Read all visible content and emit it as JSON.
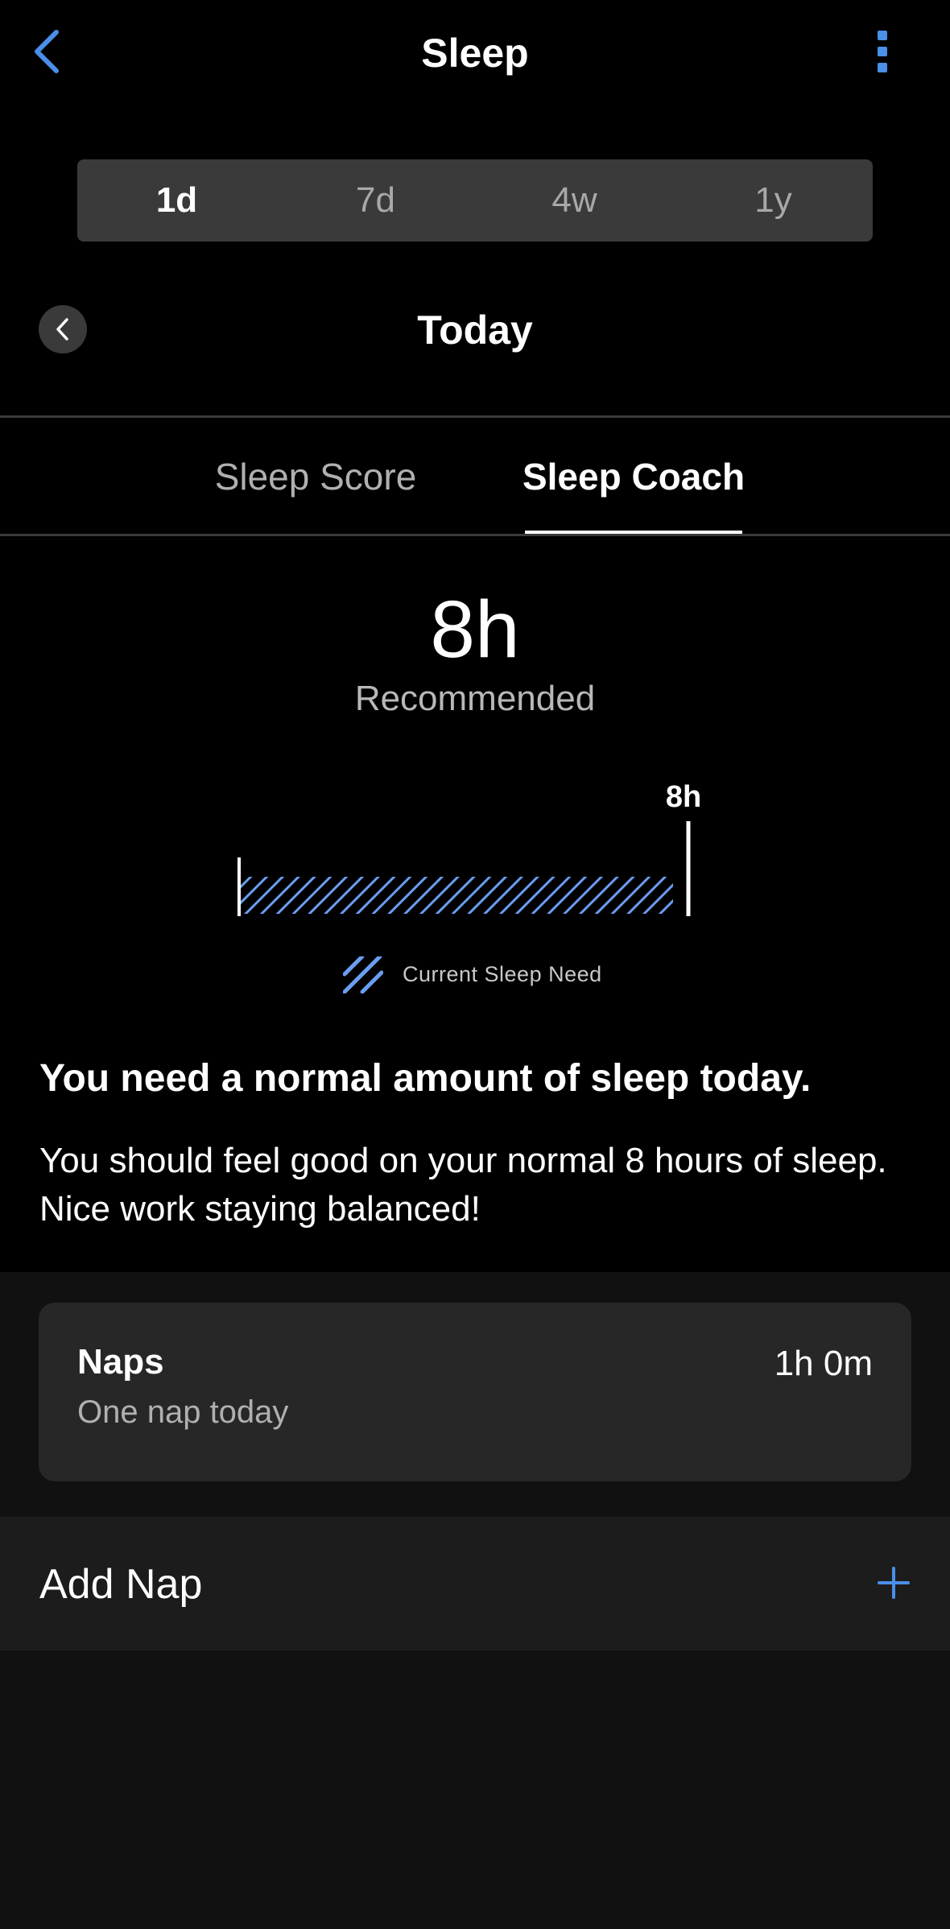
{
  "header": {
    "title": "Sleep",
    "back_icon": "chevron-left-icon",
    "menu_icon": "vertical-dots-icon"
  },
  "range_tabs": [
    {
      "label": "1d",
      "selected": true
    },
    {
      "label": "7d",
      "selected": false
    },
    {
      "label": "4w",
      "selected": false
    },
    {
      "label": "1y",
      "selected": false
    }
  ],
  "date_nav": {
    "label": "Today",
    "prev_icon": "chevron-left-icon"
  },
  "tabs": [
    {
      "label": "Sleep Score",
      "selected": false
    },
    {
      "label": "Sleep Coach",
      "selected": true
    }
  ],
  "recommended": {
    "value": "8h",
    "caption": "Recommended"
  },
  "sleep_need_bar": {
    "marker_label": "8h",
    "legend_label": "Current Sleep Need",
    "current_need_hours": 8,
    "recommended_hours": 8
  },
  "message": {
    "title": "You need a normal amount of sleep today.",
    "body": "You should feel good on your normal 8 hours of sleep. Nice work staying balanced!"
  },
  "naps": {
    "title": "Naps",
    "subtitle": "One nap today",
    "duration": "1h 0m"
  },
  "add_nap": {
    "label": "Add Nap",
    "icon": "plus-icon"
  },
  "colors": {
    "accent": "#4a8fe8",
    "hatch": "#6a9ef0",
    "background": "#000000",
    "card": "#272727"
  }
}
